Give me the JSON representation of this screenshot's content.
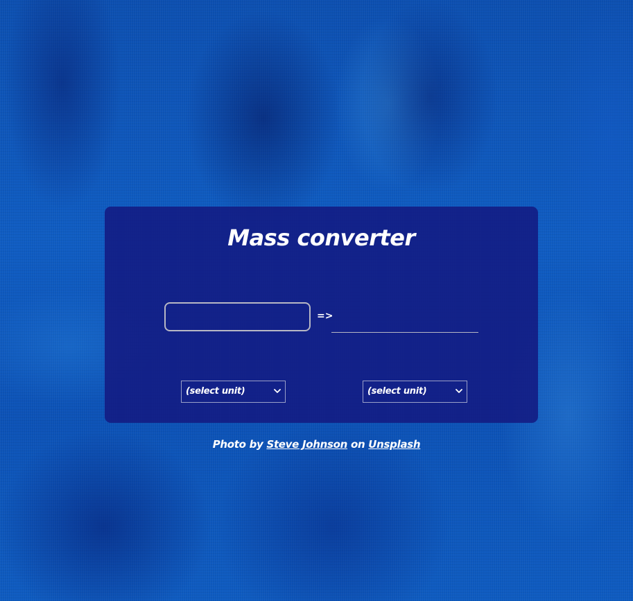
{
  "converter": {
    "title": "Mass converter",
    "arrow": "=>",
    "from_value": "",
    "to_value": "",
    "from_unit_selected": "(select unit)",
    "to_unit_selected": "(select unit)"
  },
  "credit": {
    "prefix": "Photo by",
    "author": "Steve Johnson",
    "middle": "on",
    "source": "Unsplash"
  },
  "icons": {
    "select_chevron": "chevron-down-icon"
  },
  "colors": {
    "card_background": "#131a82",
    "text": "#ffffff",
    "background": "#0f56b8"
  }
}
